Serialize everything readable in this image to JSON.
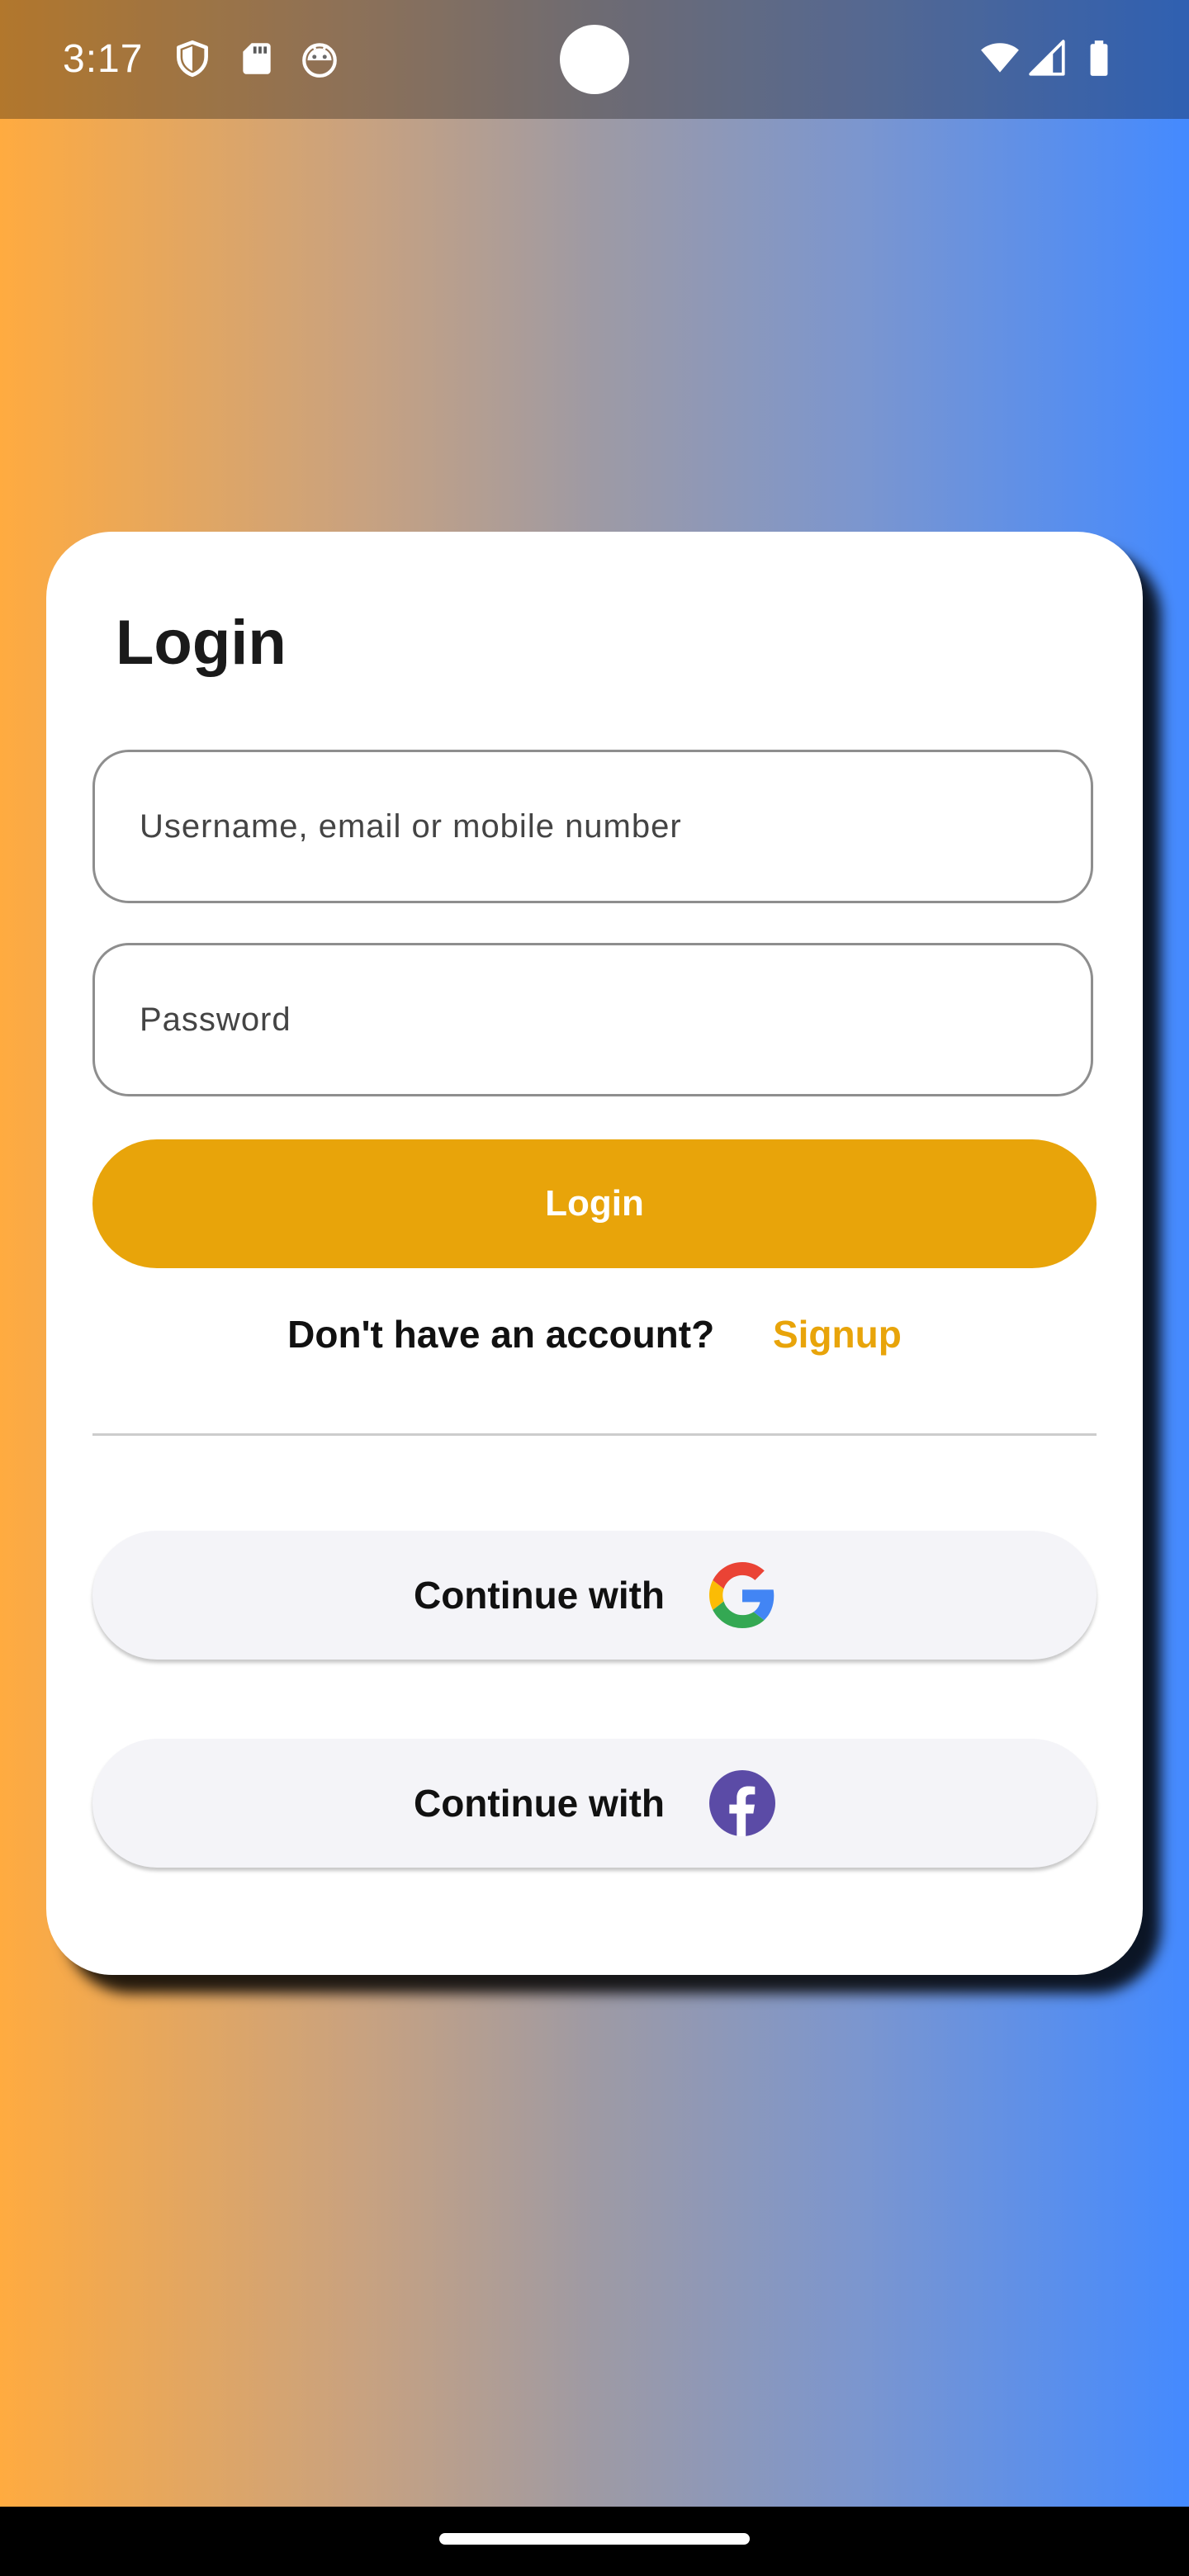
{
  "status_bar": {
    "time": "3:17",
    "left_icons": [
      "shield-icon",
      "sd-card-icon",
      "android-icon"
    ],
    "right_icons": [
      "wifi-icon",
      "cell-signal-icon",
      "battery-icon"
    ]
  },
  "background": {
    "gradient_start": "#FFAB40",
    "gradient_end": "#448AFF"
  },
  "login_card": {
    "title": "Login",
    "username_placeholder": "Username, email or mobile number",
    "username_value": "",
    "password_placeholder": "Password",
    "password_value": "",
    "login_button_label": "Login",
    "signup_prompt": "Don't have an account?",
    "signup_link": "Signup",
    "accent_color": "#E8A40A"
  },
  "social_login": [
    {
      "label": "Continue with",
      "icon": "google-icon"
    },
    {
      "label": "Continue with",
      "icon": "facebook-icon"
    }
  ]
}
